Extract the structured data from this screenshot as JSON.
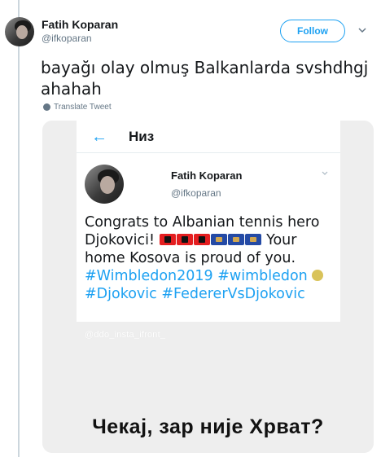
{
  "tweet": {
    "author_name": "Fatih Koparan",
    "author_handle": "@ifkoparan",
    "follow_label": "Follow",
    "text": "bayağı olay olmuş Balkanlarda svshdhgj ahahah",
    "translate_label": "Translate Tweet"
  },
  "media": {
    "screen_title": "Низ",
    "back_icon": "←",
    "quoted": {
      "author_name": "Fatih Koparan",
      "author_handle": "@ifkoparan",
      "text_start": "Congrats to Albanian tennis hero Djokovici! ",
      "flags": [
        "albania",
        "albania",
        "albania",
        "kosovo",
        "kosovo",
        "kosovo"
      ],
      "text_after_flags": " Your home Kosova is proud of you. ",
      "hashtags_line1": "#Wimbledon2019 #wimbledon",
      "emoji": "tennis-ball",
      "hashtags_line2": "#Djokovic #FedererVsDjokovic"
    },
    "watermark": "@ddo_insta_ifront_",
    "caption": "Чекај, зар није Хрват?"
  },
  "colors": {
    "accent": "#1da1f2",
    "text": "#14171a",
    "muted": "#657786",
    "media_bg": "#eeeeee"
  }
}
